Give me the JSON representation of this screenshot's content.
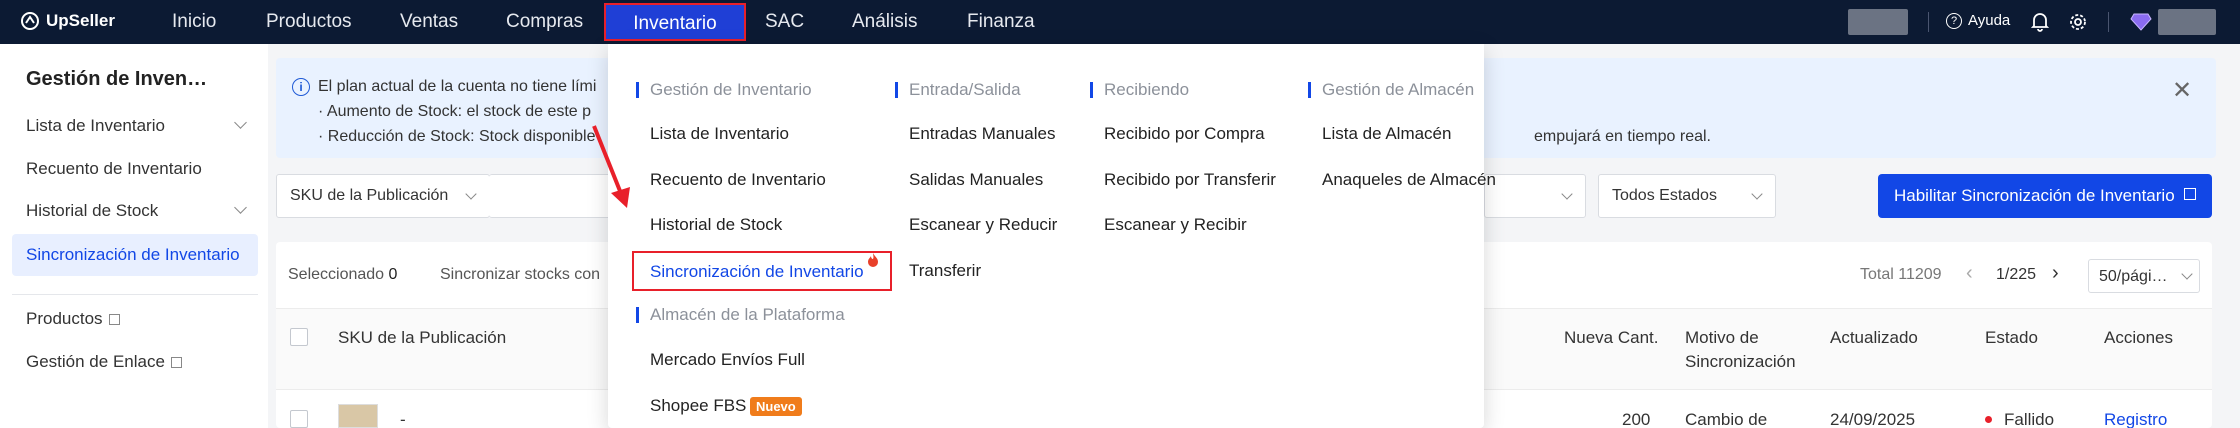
{
  "app": {
    "logo": "UpSeller"
  },
  "nav": {
    "items": [
      "Inicio",
      "Productos",
      "Ventas",
      "Compras",
      "Inventario",
      "SAC",
      "Análisis",
      "Finanza"
    ],
    "active": "Inventario",
    "help": "Ayuda"
  },
  "sidebar": {
    "title": "Gestión de Inven…",
    "items": [
      {
        "label": "Lista de Inventario"
      },
      {
        "label": "Recuento de Inventario"
      },
      {
        "label": "Historial de Stock"
      },
      {
        "label": "Sincronización de Inventario"
      },
      {
        "label": "Productos"
      },
      {
        "label": "Gestión de Enlace"
      }
    ]
  },
  "banner": {
    "line1": "El plan actual de la cuenta no tiene lími",
    "line2": "· Aumento de Stock: el stock de este p",
    "line3": "· Reducción de Stock: Stock disponible",
    "line3_tail": "empujará en tiempo real."
  },
  "filters": {
    "sku_select": "SKU de la Publicación",
    "status_select": "Todos Estados",
    "enable_button": "Habilitar Sincronización de Inventario"
  },
  "table": {
    "selected_label": "Seleccionado",
    "selected_count": "0",
    "sync_label": "Sincronizar stocks con",
    "total": "Total 11209",
    "page": "1/225",
    "page_size": "50/pági…",
    "columns": {
      "sku": "SKU de la Publicación",
      "new_qty": "Nueva Cant.",
      "reason_1": "Motivo de",
      "reason_2": "Sincronización",
      "updated": "Actualizado",
      "status": "Estado",
      "actions": "Acciones"
    },
    "row": {
      "sku": "-",
      "new_qty": "200",
      "reason": "Cambio de",
      "updated": "24/09/2025",
      "status": "Fallido",
      "action": "Registro"
    }
  },
  "menu": {
    "groups": {
      "gestion": {
        "heading": "Gestión de Inventario",
        "items": [
          "Lista de Inventario",
          "Recuento de Inventario",
          "Historial de Stock",
          "Sincronización de Inventario"
        ]
      },
      "plataforma": {
        "heading": "Almacén de la Plataforma",
        "items": [
          "Mercado Envíos Full",
          "Shopee FBS"
        ],
        "badge": "Nuevo"
      },
      "entrada": {
        "heading": "Entrada/Salida",
        "items": [
          "Entradas Manuales",
          "Salidas Manuales",
          "Escanear y Reducir",
          "Transferir"
        ]
      },
      "recibiendo": {
        "heading": "Recibiendo",
        "items": [
          "Recibido por Compra",
          "Recibido por Transferir",
          "Escanear y Recibir"
        ]
      },
      "almacen": {
        "heading": "Gestión de Almacén",
        "items": [
          "Lista de Almacén",
          "Anaqueles de Almacén"
        ]
      }
    }
  },
  "colors": {
    "nav_bg": "#0c1a33",
    "accent": "#1247e6",
    "highlight": "#e8202a",
    "badge": "#f07c1b"
  }
}
